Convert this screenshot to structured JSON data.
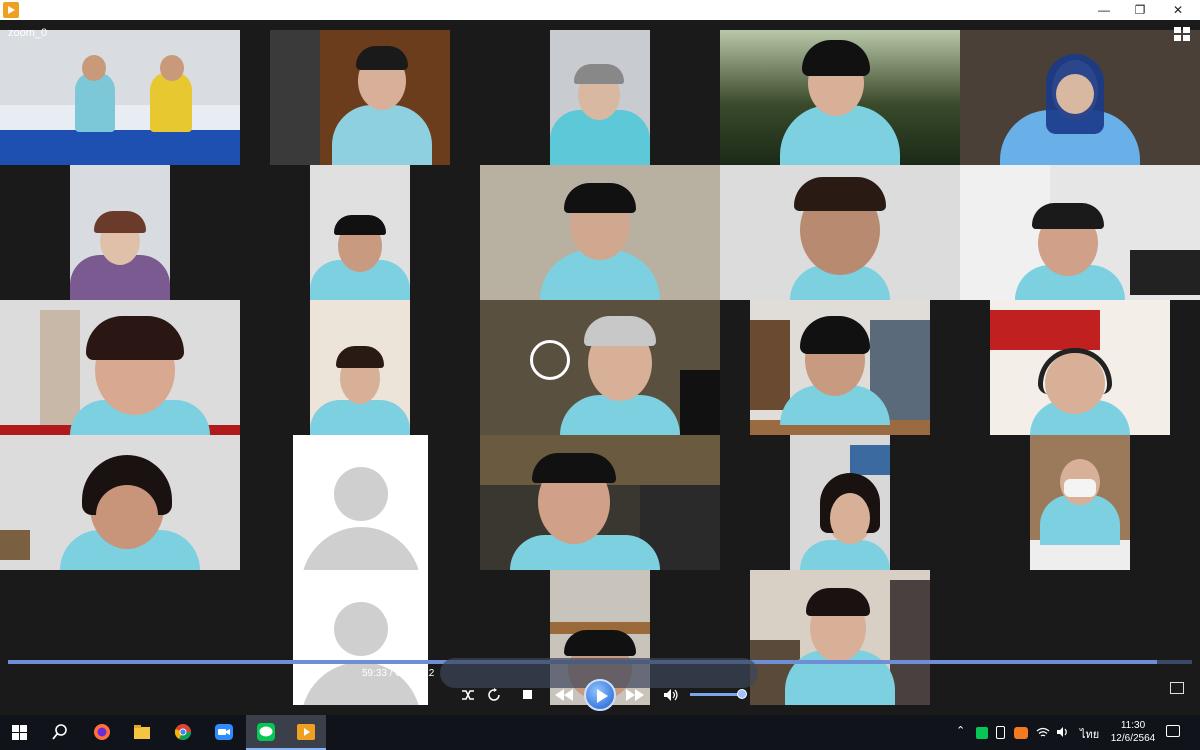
{
  "window": {
    "title": "",
    "icons": [
      "media-player-icon",
      "minimize-icon",
      "maximize-icon",
      "close-icon"
    ]
  },
  "video": {
    "title": "zoom_0",
    "participants_view_icon": "gallery-view-icon"
  },
  "player": {
    "elapsed": "59:33",
    "duration": "01:01:22",
    "time_display": "59:33 / 01:01:22",
    "progress_fraction": 0.9705,
    "volume_fraction": 0.95,
    "accent_color": "#2f7ff0",
    "controls": [
      "shuffle-icon",
      "repeat-icon",
      "stop-icon",
      "previous-icon",
      "play-icon",
      "next-icon",
      "volume-icon"
    ]
  },
  "taskbar": {
    "apps": [
      "windows-start-icon",
      "search-icon",
      "firefox-icon",
      "file-explorer-icon",
      "chrome-icon",
      "zoom-icon",
      "line-icon",
      "media-player-icon"
    ],
    "language": "ไทย",
    "time": "11:30",
    "date": "12/6/2564"
  }
}
